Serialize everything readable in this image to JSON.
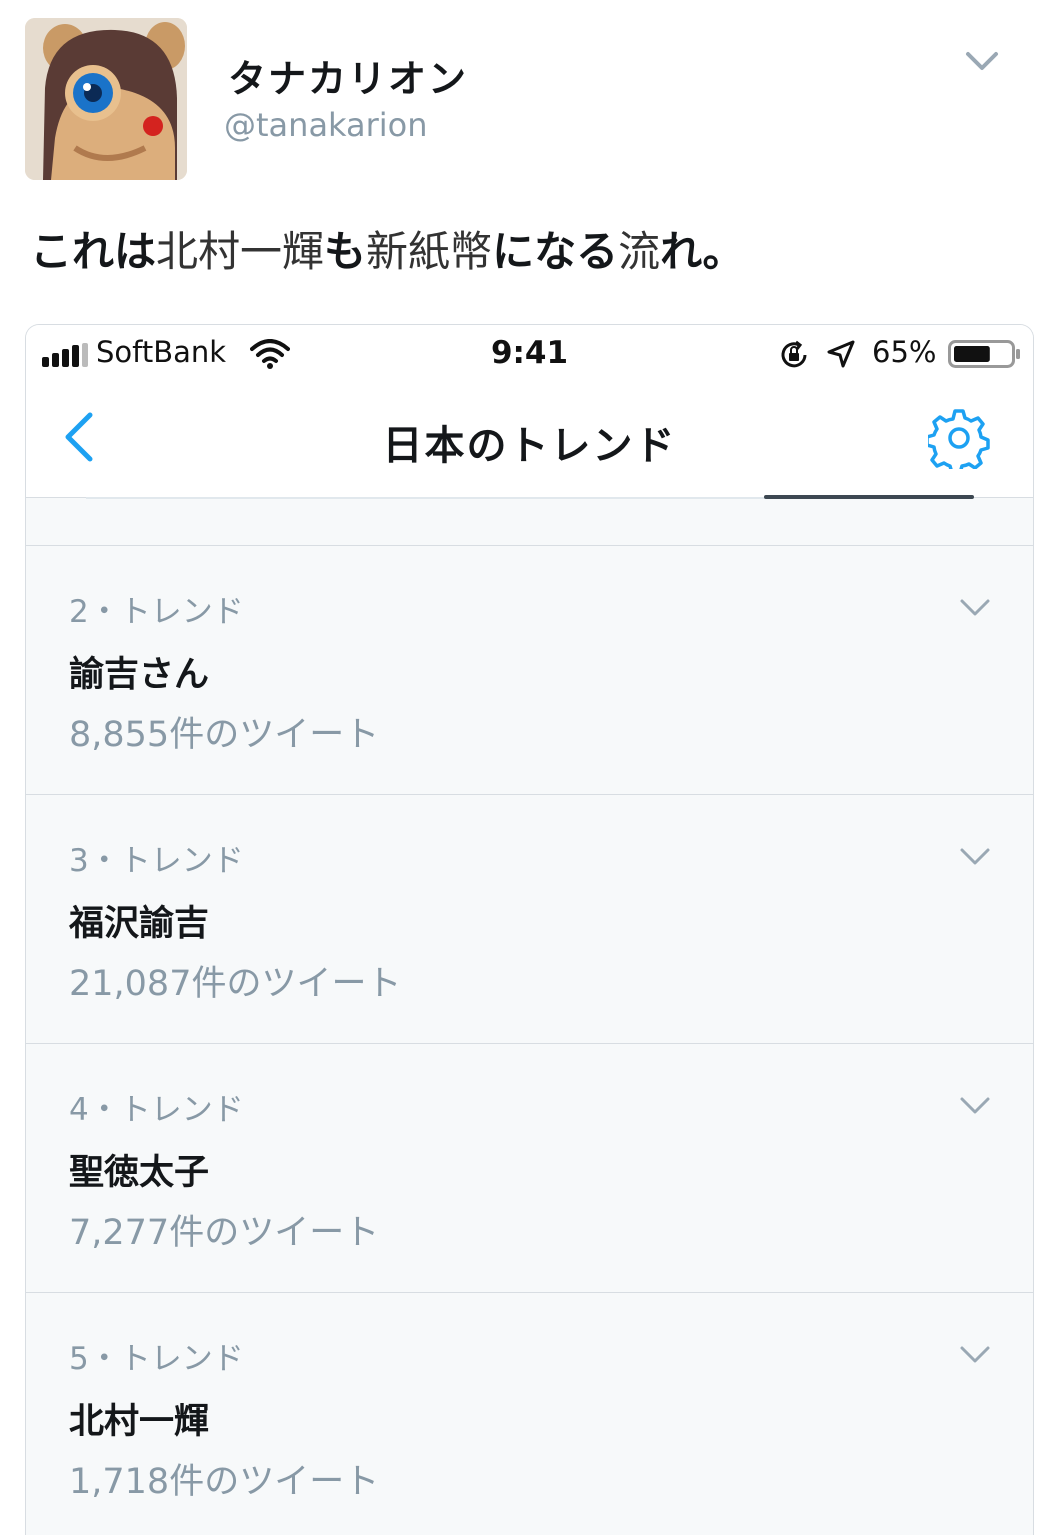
{
  "tweet": {
    "display_name": "タナカリオン",
    "handle": "@tanakarion",
    "text_parts": [
      {
        "text": "これは",
        "bold": true
      },
      {
        "text": "北村一輝",
        "bold": false
      },
      {
        "text": "も",
        "bold": true
      },
      {
        "text": "新紙幣",
        "bold": false
      },
      {
        "text": "になる",
        "bold": true
      },
      {
        "text": "流",
        "bold": false
      },
      {
        "text": "れ。",
        "bold": true
      }
    ],
    "avatar_icon": "figure-avatar-icon",
    "menu_icon": "chevron-down-icon"
  },
  "screenshot": {
    "status": {
      "carrier": "SoftBank",
      "time": "9:41",
      "battery": "65%",
      "battery_level": 0.65
    },
    "nav": {
      "title": "日本のトレンド",
      "back_icon": "chevron-left-icon",
      "settings_icon": "gear-icon"
    },
    "trends": [
      {
        "meta": "2・トレンド",
        "name": "諭吉さん",
        "count": "8,855件のツイート"
      },
      {
        "meta": "3・トレンド",
        "name": "福沢諭吉",
        "count": "21,087件のツイート"
      },
      {
        "meta": "4・トレンド",
        "name": "聖徳太子",
        "count": "7,277件のツイート"
      },
      {
        "meta": "5・トレンド",
        "name": "北村一輝",
        "count": "1,718件のツイート"
      }
    ]
  },
  "colors": {
    "accent": "#1da1f2",
    "muted": "#8899a6",
    "text": "#14171a",
    "background": "#f7f9fa"
  }
}
